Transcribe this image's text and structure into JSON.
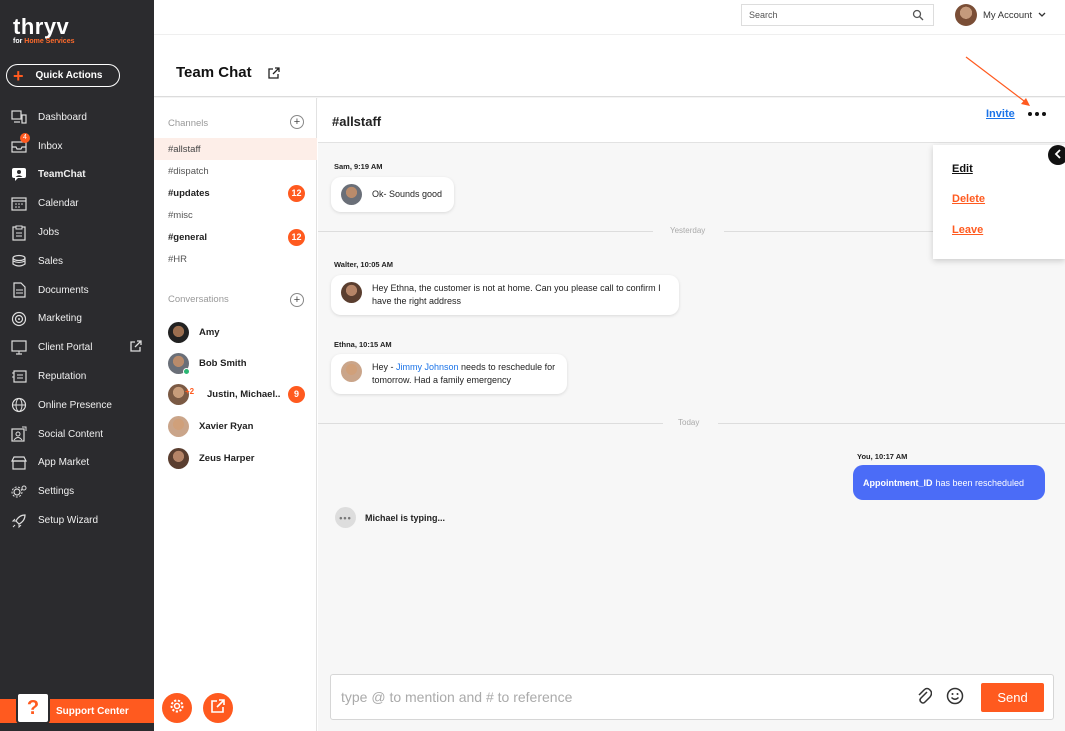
{
  "brand": {
    "name": "thryv",
    "sub_prefix": "for ",
    "sub_highlight": "Home Services"
  },
  "quick_actions": "Quick Actions",
  "nav": [
    {
      "label": "Dashboard",
      "icon": "dashboard-icon"
    },
    {
      "label": "Inbox",
      "icon": "inbox-icon",
      "badge": "4"
    },
    {
      "label": "TeamChat",
      "icon": "teamchat-icon",
      "active": true
    },
    {
      "label": "Calendar",
      "icon": "calendar-icon"
    },
    {
      "label": "Jobs",
      "icon": "jobs-icon"
    },
    {
      "label": "Sales",
      "icon": "sales-icon"
    },
    {
      "label": "Documents",
      "icon": "documents-icon"
    },
    {
      "label": "Marketing",
      "icon": "marketing-icon"
    },
    {
      "label": "Client Portal",
      "icon": "client-portal-icon",
      "external": true
    },
    {
      "label": "Reputation",
      "icon": "reputation-icon"
    },
    {
      "label": "Online Presence",
      "icon": "globe-icon"
    },
    {
      "label": "Social Content",
      "icon": "social-content-icon"
    },
    {
      "label": "App Market",
      "icon": "app-market-icon"
    },
    {
      "label": "Settings",
      "icon": "settings-icon"
    },
    {
      "label": "Setup Wizard",
      "icon": "rocket-icon"
    }
  ],
  "support": {
    "icon_text": "?",
    "label": "Support Center"
  },
  "topbar": {
    "search_placeholder": "Search",
    "account_label": "My Account"
  },
  "page": {
    "title": "Team Chat"
  },
  "channels": {
    "header": "Channels",
    "add": "+",
    "items": [
      {
        "name": "#allstaff",
        "selected": true
      },
      {
        "name": "#dispatch"
      },
      {
        "name": "#updates",
        "unread": "12",
        "bold": true
      },
      {
        "name": "#misc"
      },
      {
        "name": "#general",
        "unread": "12",
        "bold": true
      },
      {
        "name": "#HR"
      }
    ]
  },
  "conversations": {
    "header": "Conversations",
    "add": "+",
    "items": [
      {
        "name": "Amy"
      },
      {
        "name": "Bob Smith",
        "online": true
      },
      {
        "name": "Justin, Michael..",
        "extra": "+2",
        "unread": "9"
      },
      {
        "name": "Xavier Ryan"
      },
      {
        "name": "Zeus Harper"
      }
    ]
  },
  "chat": {
    "channel": "#allstaff",
    "invite": "Invite",
    "menu": [
      "Edit",
      "Delete",
      "Leave"
    ],
    "menu_colors": {
      "edit": "#111111",
      "delete": "#ff5a1f",
      "leave": "#ff5a1f"
    },
    "messages": [
      {
        "meta": "Sam, 9:19 AM",
        "text": "Ok- Sounds good"
      },
      {
        "meta": "Walter, 10:05 AM",
        "line1": "Hey Ethna, the customer is not at home. Can you please call to confirm I",
        "line2": "have the right address"
      },
      {
        "meta": "Ethna, 10:15 AM",
        "pre": "Hey - ",
        "mention": "Jimmy Johnson",
        "post": " needs to reschedule for",
        "line2": "tomorrow. Had a family emergency"
      }
    ],
    "dividers": [
      "Yesterday",
      "Today"
    ],
    "mine": {
      "meta": "You, 10:17 AM",
      "bold": "Appointment_ID",
      "text": "has been rescheduled"
    },
    "typing": "Michael is typing...",
    "composer": {
      "placeholder": "type @ to mention and # to reference",
      "send": "Send"
    }
  },
  "colors": {
    "accent": "#ff5a1f",
    "nav_bg": "#2b2b2e",
    "mine_bubble": "#4b6cf7",
    "link": "#1a73e8"
  }
}
